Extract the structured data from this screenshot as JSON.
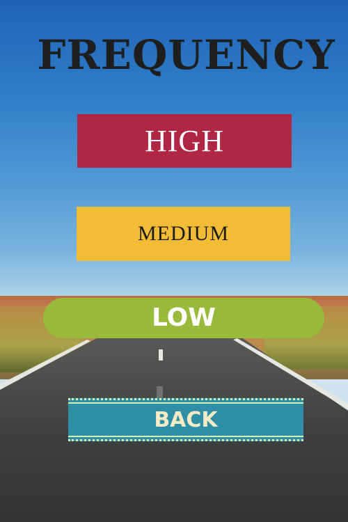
{
  "screen": {
    "title": "FREQUENCY",
    "options": {
      "high": "HIGH",
      "medium": "MEDIUM",
      "low": "LOW"
    },
    "back_label": "BACK"
  },
  "colors": {
    "high": "#b02745",
    "medium": "#f2bc36",
    "low": "#9aba3b",
    "back": "#2f8fa7",
    "title": "#1e1e1e"
  }
}
